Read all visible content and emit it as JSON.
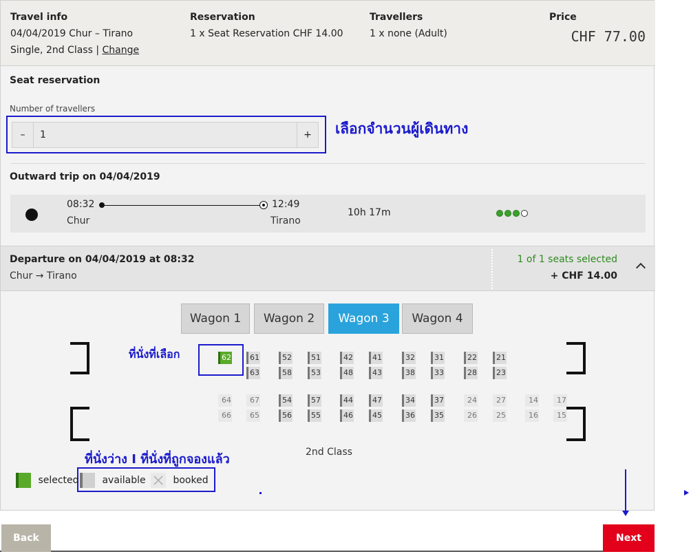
{
  "summary": {
    "travel_info": {
      "heading": "Travel info",
      "route": "04/04/2019 Chur – Tirano",
      "ticket": "Single, 2nd Class | ",
      "change_link": "Change"
    },
    "reservation": {
      "heading": "Reservation",
      "line": "1 x Seat Reservation CHF 14.00"
    },
    "travellers": {
      "heading": "Travellers",
      "line": "1 x none (Adult)"
    },
    "price": {
      "heading": "Price",
      "value": "CHF 77.00"
    }
  },
  "seat_reservation": {
    "title": "Seat reservation",
    "travellers_label": "Number of travellers",
    "minus": "–",
    "plus": "+",
    "count": "1",
    "annotation": "เลือกจำนวนผู้เดินทาง"
  },
  "outward": {
    "title": "Outward trip on 04/04/2019",
    "dep_time": "08:32",
    "dep_station": "Chur",
    "arr_time": "12:49",
    "arr_station": "Tirano",
    "duration": "10h 17m",
    "occupancy_filled": 3,
    "occupancy_total": 4
  },
  "departure": {
    "title": "Departure on 04/04/2019 at 08:32",
    "route": "Chur → Tirano",
    "seats_selected": "1 of 1 seats selected",
    "extra_price": "+ CHF 14.00"
  },
  "wagons": [
    "Wagon 1",
    "Wagon 2",
    "Wagon 3",
    "Wagon 4"
  ],
  "active_wagon": 2,
  "seat_annotation": "ที่นั่งที่เลือก",
  "class_label": "2nd Class",
  "legend": {
    "annotation": "ที่นั่งว่าง I ที่นั่งที่ถูกจองแล้ว",
    "selected": "selected",
    "available": "available",
    "booked": "booked"
  },
  "nav": {
    "back": "Back",
    "next": "Next"
  },
  "colors": {
    "accent": "#2aa3dc",
    "selected": "#5aaa2a",
    "primary": "#e2001a",
    "annotation": "#1a1acc",
    "success_text": "#2e8b1f"
  }
}
